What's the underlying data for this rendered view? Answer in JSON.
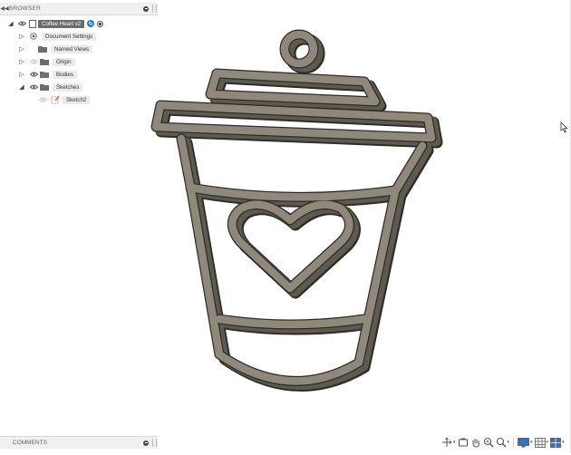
{
  "browser": {
    "title": "BROWSER",
    "document_name": "Coffee Heart v2",
    "items": [
      {
        "label": "Document Settings"
      },
      {
        "label": "Named Views"
      },
      {
        "label": "Origin"
      },
      {
        "label": "Bodies"
      },
      {
        "label": "Sketches"
      },
      {
        "label": "Sketch2"
      }
    ]
  },
  "comments": {
    "title": "COMMENTS"
  },
  "colors": {
    "model_face": "#8e897b",
    "model_side": "#5e5a50",
    "model_edge": "#2e2c27",
    "selected_label": "#6b6b6b",
    "link_badge": "#1a79d6"
  },
  "navbar": {
    "tools": [
      "orbit-icon",
      "look-at-icon",
      "pan-icon",
      "zoom-icon",
      "fit-icon",
      "display-settings-icon",
      "grid-icon",
      "viewports-icon"
    ]
  }
}
